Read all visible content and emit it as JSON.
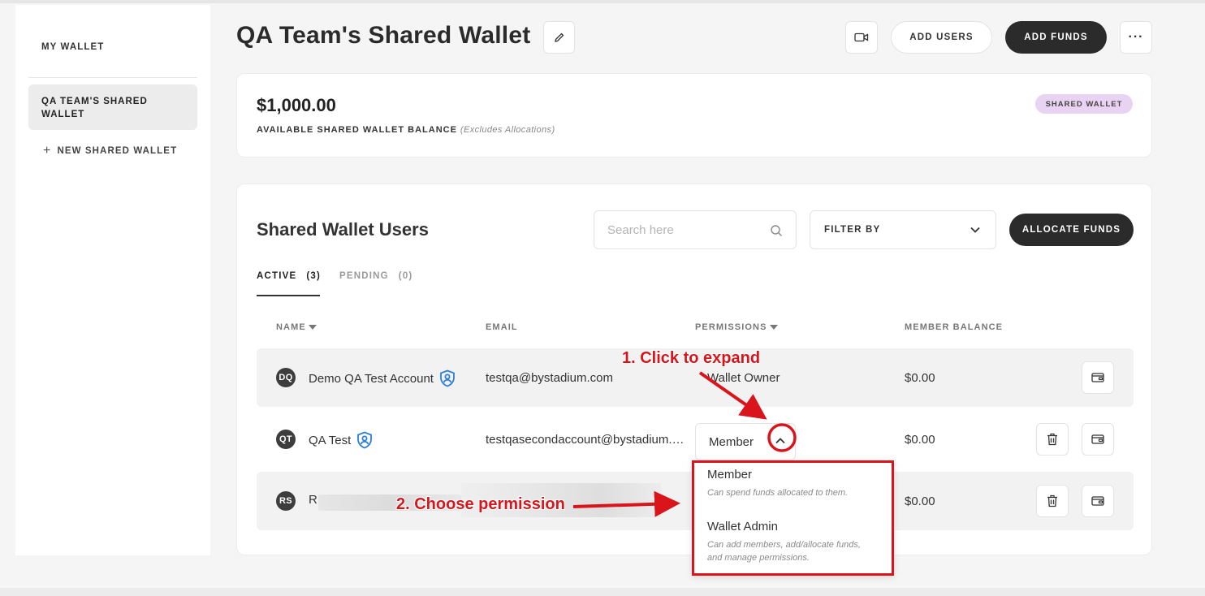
{
  "sidebar": {
    "my_wallet": "MY WALLET",
    "active_wallet": "QA TEAM'S SHARED WALLET",
    "new_wallet": "NEW SHARED WALLET"
  },
  "header": {
    "title": "QA Team's Shared Wallet",
    "add_users": "ADD USERS",
    "add_funds": "ADD FUNDS",
    "more": "···"
  },
  "balance": {
    "amount": "$1,000.00",
    "label": "AVAILABLE SHARED WALLET BALANCE",
    "note": "(Excludes Allocations)",
    "badge": "SHARED WALLET"
  },
  "users": {
    "title": "Shared Wallet Users",
    "search_placeholder": "Search here",
    "filter_label": "FILTER BY",
    "allocate": "ALLOCATE FUNDS",
    "tabs": [
      {
        "label": "ACTIVE",
        "count": "(3)"
      },
      {
        "label": "PENDING",
        "count": "(0)"
      }
    ],
    "columns": {
      "name": "NAME",
      "email": "EMAIL",
      "permissions": "PERMISSIONS",
      "balance": "MEMBER BALANCE"
    },
    "rows": [
      {
        "initials": "DQ",
        "name": "Demo QA Test Account",
        "email": "testqa@bystadium.com",
        "permission": "Wallet Owner",
        "balance": "$0.00"
      },
      {
        "initials": "QT",
        "name": "QA Test",
        "email": "testqasecondaccount@bystadium.com",
        "permission": "Member",
        "balance": "$0.00"
      },
      {
        "initials": "RS",
        "name": "R",
        "email": "",
        "permission": "",
        "balance": "$0.00"
      }
    ]
  },
  "dropdown": {
    "options": [
      {
        "title": "Member",
        "desc": "Can spend funds allocated to them."
      },
      {
        "title": "Wallet Admin",
        "desc": "Can add members, add/allocate funds, and manage permissions."
      }
    ]
  },
  "annotations": {
    "step1": "1. Click to expand",
    "step2": "2. Choose permission"
  },
  "colors": {
    "accent_dark": "#2b2b2b",
    "badge_bg": "#e8d4f2",
    "annotation_red": "#d9141b",
    "shield_blue": "#2f7fd8"
  }
}
